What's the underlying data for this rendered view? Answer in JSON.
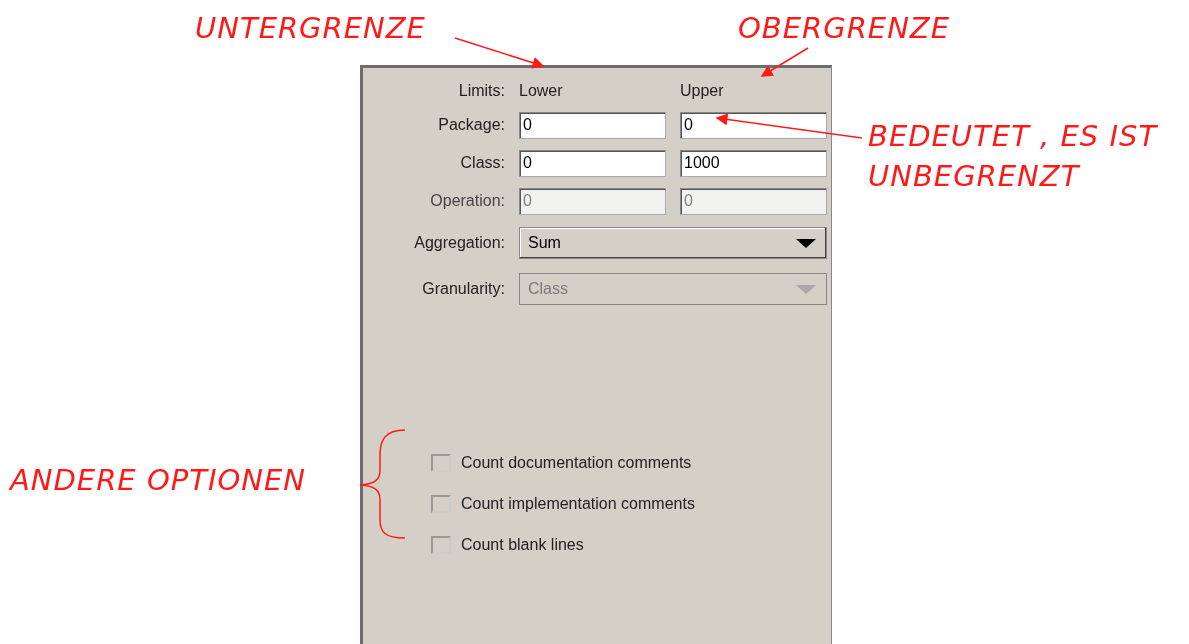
{
  "limits": {
    "label": "Limits:",
    "lower": "Lower",
    "upper": "Upper"
  },
  "rows": [
    {
      "label": "Package:",
      "lower": "0",
      "upper": "0",
      "disabled": false
    },
    {
      "label": "Class:",
      "lower": "0",
      "upper": "1000",
      "disabled": false
    },
    {
      "label": "Operation:",
      "lower": "0",
      "upper": "0",
      "disabled": true
    }
  ],
  "dropdowns": [
    {
      "label": "Aggregation:",
      "value": "Sum",
      "disabled": false
    },
    {
      "label": "Granularity:",
      "value": "Class",
      "disabled": true
    }
  ],
  "options": [
    {
      "label": "Count documentation comments",
      "checked": false
    },
    {
      "label": "Count implementation comments",
      "checked": false
    },
    {
      "label": "Count blank lines",
      "checked": false
    }
  ],
  "annotations": [
    {
      "lines": [
        "UNTERGRENZE"
      ]
    },
    {
      "lines": [
        "OBERGRENZE"
      ]
    },
    {
      "lines": [
        "BEDEUTET , ES IST",
        "UNBEGRENZT"
      ]
    },
    {
      "lines": [
        "ANDERE OPTIONEN"
      ]
    }
  ]
}
